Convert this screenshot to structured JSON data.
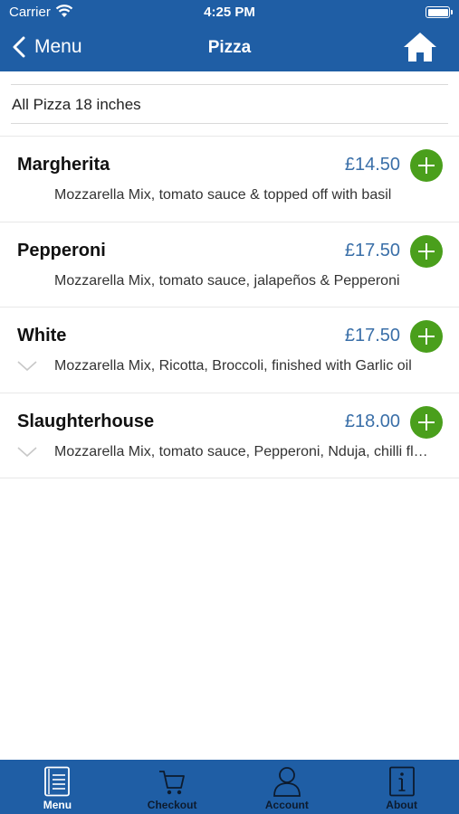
{
  "status_bar": {
    "carrier": "Carrier",
    "time": "4:25 PM"
  },
  "nav": {
    "back_label": "Menu",
    "title": "Pizza",
    "home_icon": "home-icon"
  },
  "subheader": {
    "text": "All Pizza 18 inches"
  },
  "colors": {
    "brand": "#1f5ea5",
    "price": "#3a6fa8",
    "add_button": "#4a9f1c"
  },
  "items": [
    {
      "name": "Margherita",
      "price": "£14.50",
      "description": "Mozzarella Mix, tomato sauce & topped off with basil",
      "expandable": false
    },
    {
      "name": "Pepperoni",
      "price": "£17.50",
      "description": "Mozzarella Mix, tomato sauce, jalapeños & Pepperoni",
      "expandable": false
    },
    {
      "name": "White",
      "price": "£17.50",
      "description": "Mozzarella Mix, Ricotta, Broccoli, finished with Garlic oil",
      "expandable": true
    },
    {
      "name": "Slaughterhouse",
      "price": "£18.00",
      "description": "Mozzarella Mix, tomato sauce, Pepperoni, Nduja, chilli flakes",
      "expandable": true
    }
  ],
  "tabbar": {
    "active": "Menu",
    "tabs": [
      {
        "label": "Menu",
        "icon": "menu-book-icon"
      },
      {
        "label": "Checkout",
        "icon": "cart-icon"
      },
      {
        "label": "Account",
        "icon": "person-icon"
      },
      {
        "label": "About",
        "icon": "info-icon"
      }
    ]
  }
}
